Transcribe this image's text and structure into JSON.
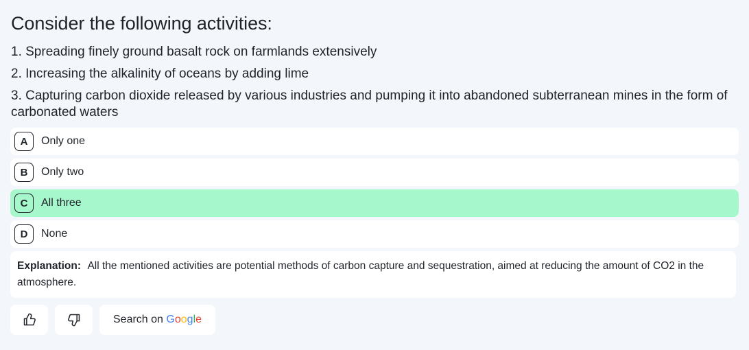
{
  "question": {
    "title": "Consider the following activities:",
    "statements": [
      "1. Spreading finely ground basalt rock on farmlands extensively",
      "2. Increasing the alkalinity of oceans by adding lime",
      "3. Capturing carbon dioxide released by various industries and pumping it into abandoned subterranean mines in the form of carbonated waters"
    ]
  },
  "options": [
    {
      "letter": "A",
      "text": "Only one",
      "correct": false
    },
    {
      "letter": "B",
      "text": "Only two",
      "correct": false
    },
    {
      "letter": "C",
      "text": "All three",
      "correct": true
    },
    {
      "letter": "D",
      "text": "None",
      "correct": false
    }
  ],
  "explanation": {
    "label": "Explanation:",
    "text": "All the mentioned activities are potential methods of carbon capture and sequestration, aimed at reducing the amount of CO2 in the atmosphere."
  },
  "actions": {
    "thumbs_up_icon": "thumbs-up-icon",
    "thumbs_down_icon": "thumbs-down-icon",
    "search_prefix": "Search on",
    "google_letters": [
      "G",
      "o",
      "o",
      "g",
      "l",
      "e"
    ]
  },
  "colors": {
    "correct_option_bg": "#a6f7cc",
    "page_bg": "#f3f6fa",
    "google_blue": "#4285f4",
    "google_red": "#ea4335",
    "google_yellow": "#fbbc05",
    "google_green": "#34a853"
  }
}
